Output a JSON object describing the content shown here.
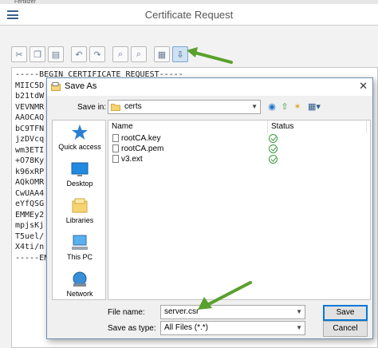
{
  "app": {
    "top_strip_text": "Fertilizer",
    "title": "Certificate Request",
    "toolbar_icons": [
      "cut-icon",
      "copy-icon",
      "paste-icon",
      "undo-icon",
      "redo-icon",
      "find-icon",
      "find-next-icon",
      "load-file-icon",
      "save-file-icon"
    ],
    "editor_lines": [
      "-----BEGIN CERTIFICATE REQUEST-----",
      "MIIC5D",
      "b21tdW",
      "VEVNMR",
      "AAOCAQ",
      "bC9TFN",
      "jzDVcq",
      "wm3ETI",
      "+O78Ky",
      "k96xRP",
      "AQkOMR",
      "CwUAA4",
      "eYfQSG",
      "EMMEy2",
      "mpjsKj",
      "T5uel/",
      "X4ti/n",
      "-----EN"
    ]
  },
  "dialog": {
    "title": "Save As",
    "close_glyph": "✕",
    "save_in_label": "Save in:",
    "save_in_value": "certs",
    "places": [
      {
        "label": "Quick access",
        "icon": "star-icon"
      },
      {
        "label": "Desktop",
        "icon": "desktop-icon"
      },
      {
        "label": "Libraries",
        "icon": "libraries-icon"
      },
      {
        "label": "This PC",
        "icon": "computer-icon"
      },
      {
        "label": "Network",
        "icon": "network-icon"
      }
    ],
    "columns": [
      "Name",
      "Status",
      "D"
    ],
    "files": [
      {
        "name": "rootCA.key",
        "status": "synced"
      },
      {
        "name": "rootCA.pem",
        "status": "synced"
      },
      {
        "name": "v3.ext",
        "status": "synced"
      }
    ],
    "file_name_label": "File name:",
    "file_name_value": "server.csr",
    "save_type_label": "Save as type:",
    "save_type_value": "All Files (*.*)",
    "save_button": "Save",
    "cancel_button": "Cancel",
    "nav_icons": [
      "back-icon",
      "up-folder-icon",
      "new-folder-icon",
      "view-menu-icon"
    ]
  },
  "colors": {
    "annotation_arrow": "#5aa02c",
    "accent": "#0078d7",
    "status_ok": "#3d9a3d"
  }
}
